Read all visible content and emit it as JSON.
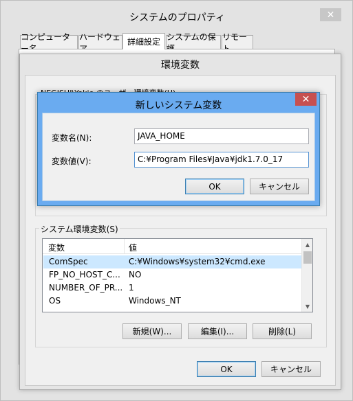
{
  "outer_window": {
    "title": "システムのプロパティ",
    "close": "✕",
    "tabs": [
      {
        "label": "コンピューター名"
      },
      {
        "label": "ハードウェア"
      },
      {
        "label": "詳細設定"
      },
      {
        "label": "システムの保護"
      },
      {
        "label": "リモート"
      }
    ]
  },
  "env_window": {
    "title": "環境変数",
    "user_section_fragment": "NEGISHI\\Yokio のユーザー環境変数(U)",
    "system_section_label": "システム環境変数(S)",
    "columns": {
      "name": "変数",
      "value": "値"
    },
    "rows": [
      {
        "name": "ComSpec",
        "value": "C:¥Windows¥system32¥cmd.exe"
      },
      {
        "name": "FP_NO_HOST_C...",
        "value": "NO"
      },
      {
        "name": "NUMBER_OF_PR...",
        "value": "1"
      },
      {
        "name": "OS",
        "value": "Windows_NT"
      }
    ],
    "new_button": "新規(W)...",
    "edit_button": "編集(I)...",
    "delete_button": "削除(L)",
    "ok_button": "OK",
    "cancel_button": "キャンセル"
  },
  "new_var_dialog": {
    "title": "新しいシステム変数",
    "close": "✕",
    "name_label": "変数名(N):",
    "value_label": "変数値(V):",
    "name_value": "JAVA_HOME",
    "value_value": "C:¥Program Files¥Java¥jdk1.7.0_17",
    "ok_button": "OK",
    "cancel_button": "キャンセル"
  },
  "colors": {
    "dialog_frame": "#6aabf0",
    "selection": "#cce8ff",
    "close_red": "#c75050"
  }
}
